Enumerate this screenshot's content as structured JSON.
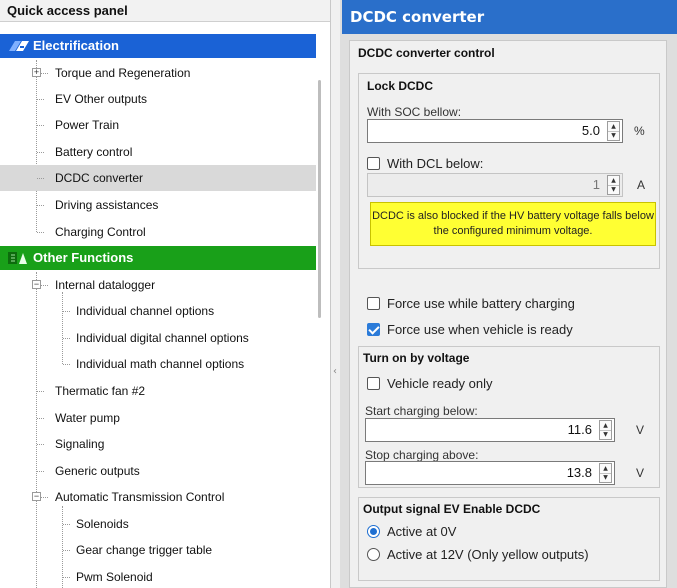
{
  "left_panel": {
    "title": "Quick access panel",
    "sections": [
      {
        "label": "Electrification",
        "color": "#1a62d6",
        "items": [
          {
            "label": "Torque and Regeneration",
            "expandable": true
          },
          {
            "label": "EV Other outputs"
          },
          {
            "label": "Power Train"
          },
          {
            "label": "Battery control"
          },
          {
            "label": "DCDC converter",
            "selected": true
          },
          {
            "label": "Driving assistances"
          },
          {
            "label": "Charging Control"
          }
        ]
      },
      {
        "label": "Other Functions",
        "color": "#19a019",
        "items": [
          {
            "label": "Internal datalogger",
            "expanded": true
          },
          {
            "label": "Individual channel options",
            "child": true
          },
          {
            "label": "Individual digital channel options",
            "child": true
          },
          {
            "label": "Individual math channel options",
            "child": true
          },
          {
            "label": "Thermatic fan #2"
          },
          {
            "label": "Water pump"
          },
          {
            "label": "Signaling"
          },
          {
            "label": "Generic outputs"
          },
          {
            "label": "Automatic Transmission Control",
            "expanded": true
          },
          {
            "label": "Solenoids",
            "child": true
          },
          {
            "label": "Gear change trigger table",
            "child": true
          },
          {
            "label": "Pwm Solenoid",
            "child": true
          }
        ]
      }
    ]
  },
  "right_panel": {
    "title": "DCDC converter",
    "control_group_title": "DCDC converter control",
    "lock_dcdc": {
      "title": "Lock DCDC",
      "soc_label": "With SOC bellow:",
      "soc_value": "5.0",
      "soc_unit": "%",
      "dcl_label": "With DCL below:",
      "dcl_checked": false,
      "dcl_value": "1",
      "dcl_unit": "A",
      "note": "DCDC is also blocked if the HV battery voltage falls below the configured minimum voltage."
    },
    "force_charging_label": "Force use while battery charging",
    "force_charging_checked": false,
    "force_ready_label": "Force use when vehicle is ready",
    "force_ready_checked": true,
    "turn_on": {
      "title": "Turn on by voltage",
      "ready_only_label": "Vehicle ready only",
      "ready_only_checked": false,
      "start_label": "Start charging below:",
      "start_value": "11.6",
      "start_unit": "V",
      "stop_label": "Stop charging above:",
      "stop_value": "13.8",
      "stop_unit": "V"
    },
    "output_signal": {
      "title": "Output signal EV Enable DCDC",
      "option_0v": "Active at 0V",
      "option_12v": "Active at 12V (Only yellow outputs)",
      "selected": "Active at 0V"
    }
  },
  "colors": {
    "title_blue": "#2a6fca",
    "electrification_blue": "#1a62d6",
    "other_functions_green": "#19a019",
    "note_yellow": "#ffff33",
    "selection_gray": "#d9d9d9"
  },
  "icons": {
    "electrification": "electrification-icon",
    "other_functions": "other-functions-icon"
  }
}
